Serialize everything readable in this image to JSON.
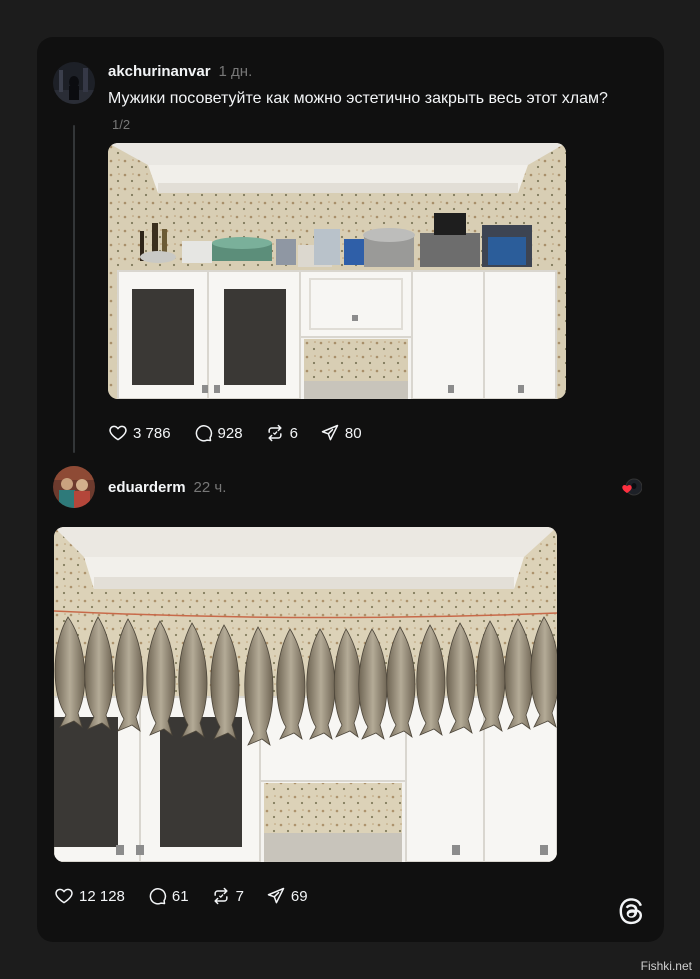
{
  "post1": {
    "username": "akchurinanvar",
    "time": "1 дн.",
    "text": "Мужики посоветуйте как можно эстетично закрыть весь этот хлам?",
    "counter": "1/2",
    "likes": "3 786",
    "comments": "928",
    "reposts": "6",
    "shares": "80"
  },
  "post2": {
    "username": "eduarderm",
    "time": "22 ч.",
    "likes": "12 128",
    "comments": "61",
    "reposts": "7",
    "shares": "69"
  },
  "icons": {
    "like": "heart-icon",
    "comment": "comment-icon",
    "repost": "repost-icon",
    "share": "share-icon",
    "logo": "threads-logo-icon"
  },
  "colors": {
    "background": "#1c1c1c",
    "card": "#101010",
    "text": "#f3f5f7",
    "muted": "#777777",
    "like_badge": "#ff3040"
  },
  "watermark": "Fishki.net"
}
